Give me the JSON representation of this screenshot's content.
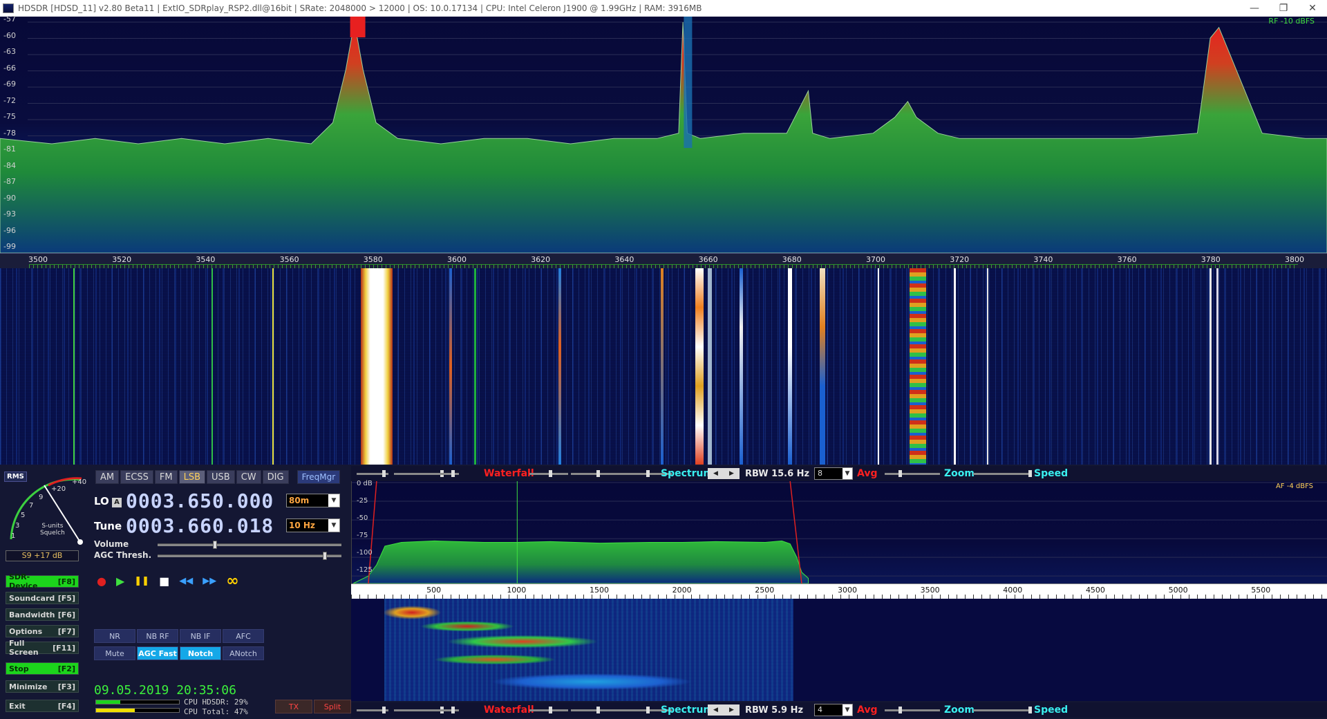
{
  "window": {
    "title": "HDSDR  [HDSD_11]  v2.80 Beta11  |  ExtIO_SDRplay_RSP2.dll@16bit  |  SRate: 2048000 > 12000  |  OS: 10.0.17134   |  CPU: Intel Celeron  J1900  @ 1.99GHz  |  RAM: 3916MB",
    "minimize": "—",
    "restore": "❐",
    "close": "✕"
  },
  "rf_spectrum": {
    "info": "RF -10 dBFS",
    "y_ticks": [
      "-57",
      "-60",
      "-63",
      "-66",
      "-69",
      "-72",
      "-75",
      "-78",
      "-81",
      "-84",
      "-87",
      "-90",
      "-93",
      "-96",
      "-99"
    ],
    "freq_ticks": [
      "3500",
      "3520",
      "3540",
      "3560",
      "3580",
      "3600",
      "3620",
      "3640",
      "3660",
      "3680",
      "3700",
      "3720",
      "3740",
      "3760",
      "3780",
      "3800"
    ]
  },
  "chart_data": [
    {
      "type": "line",
      "title": "",
      "xlabel": "",
      "ylabel": "",
      "xlim": [
        3498,
        3805
      ],
      "ylim": [
        -100,
        -57
      ],
      "series": [
        {
          "values_note": "",
          "x": [
            3498,
            3510,
            3520,
            3530,
            3540,
            3550,
            3560,
            3570,
            3575,
            3578,
            3580,
            3582,
            3585,
            3590,
            3600,
            3610,
            3620,
            3630,
            3640,
            3650,
            3655,
            3656,
            3657,
            3660,
            3670,
            3680,
            3685,
            3686,
            3690,
            3700,
            3705,
            3708,
            3710,
            3715,
            3720,
            3740,
            3760,
            3775,
            3778,
            3780,
            3782,
            3790,
            3800,
            3805
          ],
          "y": [
            -79,
            -80,
            -79,
            -80,
            -79,
            -80,
            -79,
            -80,
            -76,
            -66,
            -57,
            -66,
            -76,
            -79,
            -80,
            -79,
            -79,
            -80,
            -79,
            -79,
            -78,
            -57,
            -78,
            -79,
            -78,
            -78,
            -70,
            -78,
            -79,
            -78,
            -75,
            -72,
            -75,
            -78,
            -79,
            -79,
            -79,
            -78,
            -60,
            -58,
            -62,
            -78,
            -79,
            -79
          ]
        }
      ],
      "grid": true
    },
    {
      "type": "area",
      "title": "",
      "xlabel": "",
      "ylabel": "",
      "xlim": [
        0,
        5900
      ],
      "ylim": [
        -135,
        0
      ],
      "series": [
        {
          "x": [
            100,
            150,
            180,
            200,
            300,
            500,
            800,
            1000,
            1200,
            1500,
            1800,
            2000,
            2200,
            2500,
            2600,
            2650,
            2690,
            2720,
            2760
          ],
          "y": [
            -125,
            -110,
            -95,
            -85,
            -80,
            -78,
            -80,
            -80,
            -79,
            -81,
            -80,
            -80,
            -79,
            -80,
            -78,
            -82,
            -100,
            -120,
            -128
          ]
        }
      ],
      "y_ticks": [
        "0 dB",
        "-25",
        "-50",
        "-75",
        "-100",
        "-125"
      ],
      "x_ticks": [
        "500",
        "1000",
        "1500",
        "2000",
        "2500",
        "3000",
        "3500",
        "4000",
        "4500",
        "5000",
        "5500"
      ],
      "grid": true
    }
  ],
  "smeter": {
    "mode_badge": "RMS",
    "scale": [
      "1",
      "3",
      "5",
      "7",
      "9",
      "+20",
      "+40"
    ],
    "label_line1": "S-units",
    "label_line2": "Squelch",
    "reading": "S9 +17 dB"
  },
  "modes": [
    "AM",
    "ECSS",
    "FM",
    "LSB",
    "USB",
    "CW",
    "DIG"
  ],
  "active_mode": "LSB",
  "freqmgr": "FreqMgr",
  "lo": {
    "label": "LO",
    "badge": "A",
    "value": "0003.650.000",
    "band": "80m"
  },
  "tune": {
    "label": "Tune",
    "value": "0003.660.018",
    "step": "10 Hz"
  },
  "volume": {
    "label": "Volume",
    "level": 0.3
  },
  "agc": {
    "label": "AGC Thresh.",
    "level": 0.9
  },
  "transport": {
    "record": "●",
    "play": "▶",
    "pause": "❚❚",
    "stop": "■",
    "rewind": "◀◀",
    "forward": "▶▶",
    "loop": "∞"
  },
  "side_buttons": [
    {
      "label": "SDR-Device",
      "key": "[F8]",
      "active": true
    },
    {
      "label": "Soundcard",
      "key": "[F5]",
      "active": false
    },
    {
      "label": "Bandwidth",
      "key": "[F6]",
      "active": false
    },
    {
      "label": "Options",
      "key": "[F7]",
      "active": false
    },
    {
      "label": "Full Screen",
      "key": "[F11]",
      "active": false
    },
    {
      "label": "Stop",
      "key": "[F2]",
      "active": true
    },
    {
      "label": "Minimize",
      "key": "[F3]",
      "active": false
    },
    {
      "label": "Exit",
      "key": "[F4]",
      "active": false
    }
  ],
  "dsp": {
    "row1": [
      "NR",
      "NB RF",
      "NB IF",
      "AFC"
    ],
    "row2": [
      {
        "label": "Mute",
        "on": false
      },
      {
        "label": "AGC Fast",
        "on": true
      },
      {
        "label": "Notch",
        "on": true
      },
      {
        "label": "ANotch",
        "on": false
      }
    ]
  },
  "datetime": "09.05.2019 20:35:06",
  "cpu": {
    "hdsdr_label": "CPU HDSDR:",
    "hdsdr": "29%",
    "hdsdr_level": 0.29,
    "total_label": "CPU Total:",
    "total": "47%",
    "total_level": 0.47
  },
  "tx": "TX",
  "split": "Split",
  "rf_controls": {
    "waterfall": "Waterfall",
    "spectrum": "Spectrum",
    "rbw": "RBW 15.6 Hz",
    "avg_value": "8",
    "avg": "Avg",
    "zoom": "Zoom",
    "speed": "Speed"
  },
  "af_controls": {
    "waterfall": "Waterfall",
    "spectrum": "Spectrum",
    "rbw": "RBW  5.9 Hz",
    "avg_value": "4",
    "avg": "Avg",
    "zoom": "Zoom",
    "speed": "Speed"
  },
  "af_info": "AF  -4 dBFS",
  "colors": {
    "green_active": "#1cd41c",
    "accent_blue": "#15a8e8",
    "waterfall_red": "#ff2020",
    "spectrum_cyan": "#3af0f0",
    "freq_blue": "#c8d4ff"
  }
}
